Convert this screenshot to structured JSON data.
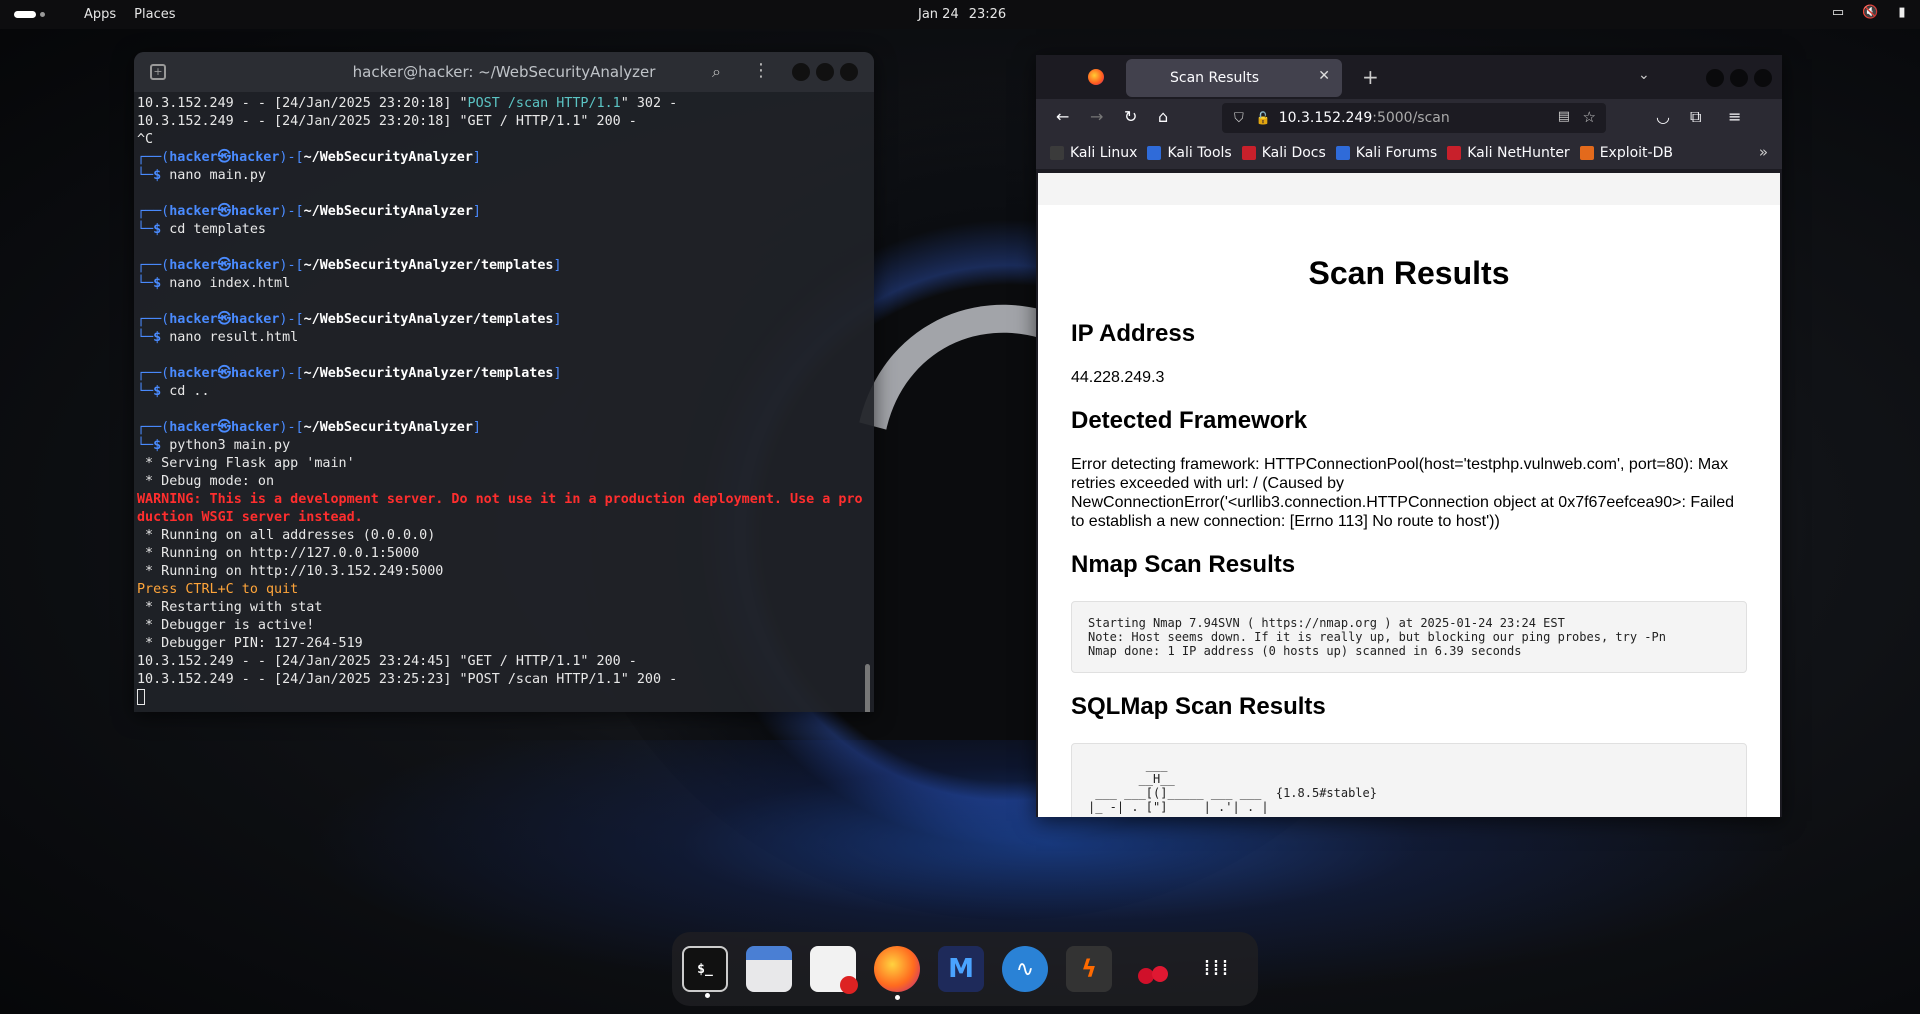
{
  "topbar": {
    "apps": "Apps",
    "places": "Places",
    "date": "Jan 24",
    "time": "23:26"
  },
  "terminal": {
    "title": "hacker@hacker: ~/WebSecurityAnalyzer",
    "lines": [
      {
        "segs": [
          [
            "10.3.152.249 - - [24/Jan/2025 23:20:18] \"",
            ""
          ],
          [
            "POST /scan HTTP/1.1",
            "c-teal"
          ],
          [
            "\" 302 -",
            ""
          ]
        ]
      },
      {
        "segs": [
          [
            "10.3.152.249 - - [24/Jan/2025 23:20:18] \"GET / HTTP/1.1\" 200 -",
            ""
          ]
        ]
      },
      {
        "segs": [
          [
            "^C",
            ""
          ]
        ]
      },
      {
        "segs": [
          [
            "┌──(",
            "c-bracket"
          ],
          [
            "hacker㉿hacker",
            "c-blue"
          ],
          [
            ")-[",
            "c-bracket"
          ],
          [
            "~/WebSecurityAnalyzer",
            "c-path"
          ],
          [
            "]",
            "c-bracket"
          ]
        ]
      },
      {
        "segs": [
          [
            "└─",
            "c-bracket"
          ],
          [
            "$ ",
            "c-blue"
          ],
          [
            "nano main.py",
            ""
          ]
        ]
      },
      {
        "segs": [
          [
            "",
            ""
          ]
        ]
      },
      {
        "segs": [
          [
            "┌──(",
            "c-bracket"
          ],
          [
            "hacker㉿hacker",
            "c-blue"
          ],
          [
            ")-[",
            "c-bracket"
          ],
          [
            "~/WebSecurityAnalyzer",
            "c-path"
          ],
          [
            "]",
            "c-bracket"
          ]
        ]
      },
      {
        "segs": [
          [
            "└─",
            "c-bracket"
          ],
          [
            "$ ",
            "c-blue"
          ],
          [
            "cd templates",
            ""
          ]
        ]
      },
      {
        "segs": [
          [
            "",
            ""
          ]
        ]
      },
      {
        "segs": [
          [
            "┌──(",
            "c-bracket"
          ],
          [
            "hacker㉿hacker",
            "c-blue"
          ],
          [
            ")-[",
            "c-bracket"
          ],
          [
            "~/WebSecurityAnalyzer/templates",
            "c-path"
          ],
          [
            "]",
            "c-bracket"
          ]
        ]
      },
      {
        "segs": [
          [
            "└─",
            "c-bracket"
          ],
          [
            "$ ",
            "c-blue"
          ],
          [
            "nano index.html",
            ""
          ]
        ]
      },
      {
        "segs": [
          [
            "",
            ""
          ]
        ]
      },
      {
        "segs": [
          [
            "┌──(",
            "c-bracket"
          ],
          [
            "hacker㉿hacker",
            "c-blue"
          ],
          [
            ")-[",
            "c-bracket"
          ],
          [
            "~/WebSecurityAnalyzer/templates",
            "c-path"
          ],
          [
            "]",
            "c-bracket"
          ]
        ]
      },
      {
        "segs": [
          [
            "└─",
            "c-bracket"
          ],
          [
            "$ ",
            "c-blue"
          ],
          [
            "nano result.html",
            ""
          ]
        ]
      },
      {
        "segs": [
          [
            "",
            ""
          ]
        ]
      },
      {
        "segs": [
          [
            "┌──(",
            "c-bracket"
          ],
          [
            "hacker㉿hacker",
            "c-blue"
          ],
          [
            ")-[",
            "c-bracket"
          ],
          [
            "~/WebSecurityAnalyzer/templates",
            "c-path"
          ],
          [
            "]",
            "c-bracket"
          ]
        ]
      },
      {
        "segs": [
          [
            "└─",
            "c-bracket"
          ],
          [
            "$ ",
            "c-blue"
          ],
          [
            "cd ..",
            ""
          ]
        ]
      },
      {
        "segs": [
          [
            "",
            ""
          ]
        ]
      },
      {
        "segs": [
          [
            "┌──(",
            "c-bracket"
          ],
          [
            "hacker㉿hacker",
            "c-blue"
          ],
          [
            ")-[",
            "c-bracket"
          ],
          [
            "~/WebSecurityAnalyzer",
            "c-path"
          ],
          [
            "]",
            "c-bracket"
          ]
        ]
      },
      {
        "segs": [
          [
            "└─",
            "c-bracket"
          ],
          [
            "$ ",
            "c-blue"
          ],
          [
            "python3 main.py",
            ""
          ]
        ]
      },
      {
        "segs": [
          [
            " * Serving Flask app 'main'",
            ""
          ]
        ]
      },
      {
        "segs": [
          [
            " * Debug mode: on",
            ""
          ]
        ]
      },
      {
        "segs": [
          [
            "WARNING: This is a development server. Do not use it in a production deployment. Use a pro",
            "c-red"
          ]
        ]
      },
      {
        "segs": [
          [
            "duction WSGI server instead.",
            "c-red"
          ]
        ]
      },
      {
        "segs": [
          [
            " * Running on all addresses (0.0.0.0)",
            ""
          ]
        ]
      },
      {
        "segs": [
          [
            " * Running on http://127.0.0.1:5000",
            ""
          ]
        ]
      },
      {
        "segs": [
          [
            " * Running on http://10.3.152.249:5000",
            ""
          ]
        ]
      },
      {
        "segs": [
          [
            "Press CTRL+C to quit",
            "c-orange"
          ]
        ]
      },
      {
        "segs": [
          [
            " * Restarting with stat",
            ""
          ]
        ]
      },
      {
        "segs": [
          [
            " * Debugger is active!",
            ""
          ]
        ]
      },
      {
        "segs": [
          [
            " * Debugger PIN: 127-264-519",
            ""
          ]
        ]
      },
      {
        "segs": [
          [
            "10.3.152.249 - - [24/Jan/2025 23:24:45] \"GET / HTTP/1.1\" 200 -",
            ""
          ]
        ]
      },
      {
        "segs": [
          [
            "10.3.152.249 - - [24/Jan/2025 23:25:23] \"POST /scan HTTP/1.1\" 200 -",
            ""
          ]
        ]
      }
    ]
  },
  "browser": {
    "tab_title": "Scan Results",
    "url_host": "10.3.152.249",
    "url_rest": ":5000/scan",
    "bookmarks": [
      {
        "label": "Kali Linux",
        "color": "#3b3b3b"
      },
      {
        "label": "Kali Tools",
        "color": "#2f6bd9"
      },
      {
        "label": "Kali Docs",
        "color": "#c8202b"
      },
      {
        "label": "Kali Forums",
        "color": "#2f6bd9"
      },
      {
        "label": "Kali NetHunter",
        "color": "#c8202b"
      },
      {
        "label": "Exploit-DB",
        "color": "#e36a1c"
      }
    ]
  },
  "page": {
    "title": "Scan Results",
    "ip_heading": "IP Address",
    "ip_value": "44.228.249.3",
    "framework_heading": "Detected Framework",
    "framework_text": "Error detecting framework: HTTPConnectionPool(host='testphp.vulnweb.com', port=80): Max retries exceeded with url: / (Caused by NewConnectionError('<urllib3.connection.HTTPConnection object at 0x7f67eefcea90>: Failed to establish a new connection: [Errno 113] No route to host'))",
    "nmap_heading": "Nmap Scan Results",
    "nmap_output": "Starting Nmap 7.94SVN ( https://nmap.org ) at 2025-01-24 23:24 EST\nNote: Host seems down. If it is really up, but blocking our ping probes, try -Pn\nNmap done: 1 IP address (0 hosts up) scanned in 6.39 seconds",
    "sqlmap_heading": "SQLMap Scan Results",
    "sqlmap_output": "        ___\n       __H__\n ___ ___[(]_____ ___ ___  {1.8.5#stable}\n|_ -| . [\"]     | .'| . |"
  },
  "dock": {
    "items": [
      "terminal-icon",
      "files-icon",
      "text-editor-icon",
      "firefox-icon",
      "metasploit-icon",
      "wireshark-icon",
      "burpsuite-icon",
      "cherrytree-icon",
      "app-grid-icon"
    ]
  }
}
